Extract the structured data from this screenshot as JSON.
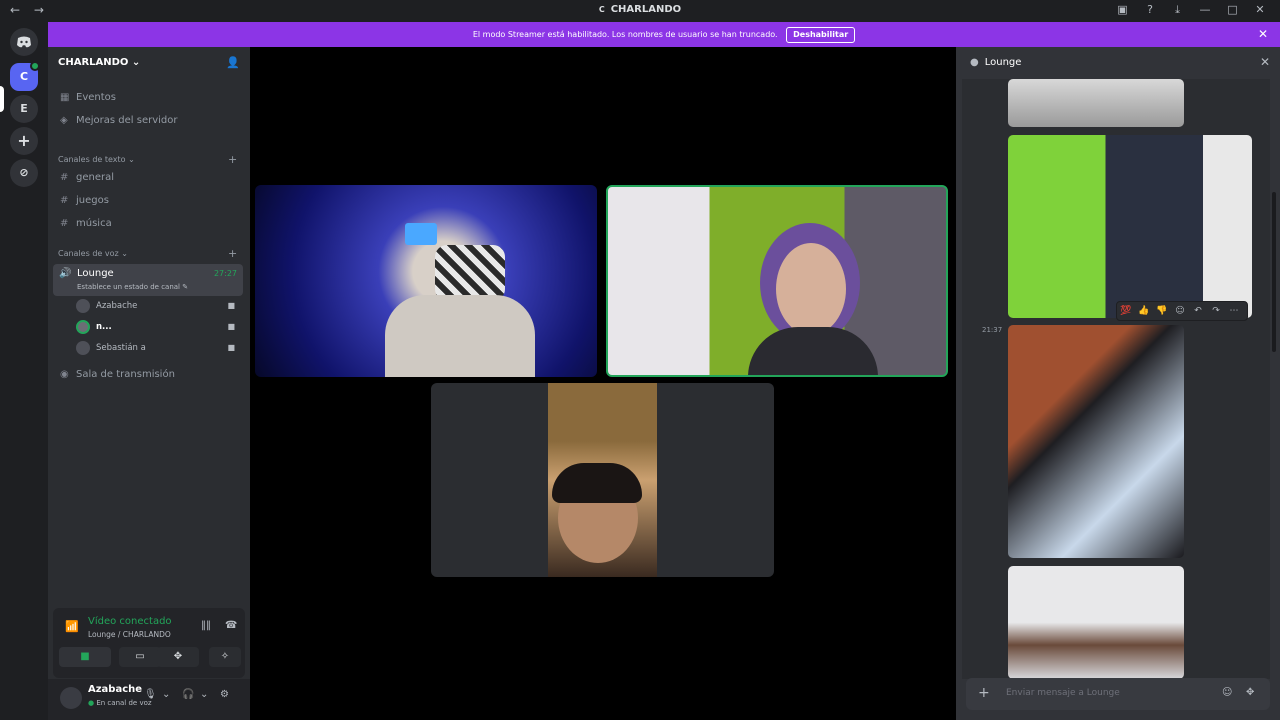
{
  "titlebar": {
    "back": "←",
    "forward": "→",
    "server_icon": "C",
    "title": "CHARLANDO",
    "controls": [
      "▣",
      "?",
      "⤓",
      "—",
      "□",
      "✕"
    ]
  },
  "guilds": {
    "discord_icon": "discord-icon",
    "active_server": "C",
    "second_server": "E",
    "add": "+",
    "explore": "⊘"
  },
  "banner": {
    "text": "El modo Streamer está habilitado. Los nombres de usuario se han truncado.",
    "button": "Deshabilitar",
    "close": "✕"
  },
  "sidebar": {
    "server_name": "CHARLANDO",
    "chevron": "⌄",
    "events": "Eventos",
    "boosts": "Mejoras del servidor",
    "text_category": "Canales de texto",
    "text_channels": [
      "general",
      "juegos",
      "música"
    ],
    "voice_category": "Canales de voz",
    "lounge": {
      "name": "Lounge",
      "time": "27:27",
      "status": "Establece un estado de canal"
    },
    "voice_users": [
      "Azabache",
      "n...",
      "Sebastián a"
    ],
    "stage": "Sala de transmisión"
  },
  "voice_panel": {
    "title": "Vídeo conectado",
    "subtitle": "Lounge / CHARLANDO",
    "user": "Azabache",
    "user_status": "En canal de voz"
  },
  "chat": {
    "title": "Lounge",
    "timestamp": "21:37",
    "placeholder": "Enviar mensaje a Lounge",
    "reactions": [
      "💯",
      "👍",
      "👎",
      "☺",
      "↶",
      "↷",
      "⋯"
    ]
  },
  "colors": {
    "accent": "#5865f2",
    "banner": "#8c35e6",
    "green": "#23a55a"
  }
}
